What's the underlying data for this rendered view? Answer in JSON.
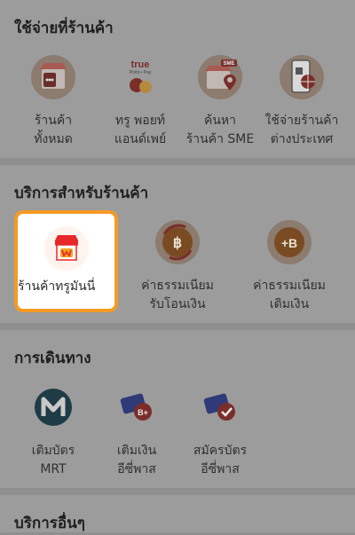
{
  "sections": {
    "spend_at_store": {
      "title": "ใช้จ่ายที่ร้านค้า",
      "items": [
        {
          "line1": "ร้านค้า",
          "line2": "ทั้งหมด",
          "icon": "store-icon"
        },
        {
          "line1": "ทรู พอยท์",
          "line2": "แอนด์เพย์",
          "icon": "true-point-pay-icon",
          "brand_top": "true",
          "brand_bottom": "Point • Pay"
        },
        {
          "line1": "ค้นหา",
          "line2": "ร้านค้า SME",
          "icon": "sme-store-location-icon",
          "badge": "SME"
        },
        {
          "line1": "ใช้จ่ายร้านค้า",
          "line2": "ต่างประเทศ",
          "icon": "international-payment-icon"
        }
      ]
    },
    "store_services": {
      "title": "บริการสำหรับร้านค้า",
      "items": [
        {
          "line1": "ร้านค้าทรูมันนี่",
          "line2": "",
          "icon": "truemoney-store-icon"
        },
        {
          "line1": "ค่าธรรมเนียม",
          "line2": "รับโอนเงิน",
          "icon": "transfer-fee-icon"
        },
        {
          "line1": "ค่าธรรมเนียม",
          "line2": "เติมเงิน",
          "icon": "topup-fee-icon",
          "coin_text": "+B"
        }
      ]
    },
    "travel": {
      "title": "การเดินทาง",
      "items": [
        {
          "line1": "เติมบัตร",
          "line2": "MRT",
          "icon": "mrt-icon"
        },
        {
          "line1": "เติมเงิน",
          "line2": "อีซี่พาส",
          "icon": "easy-pass-topup-icon",
          "badge": "B+"
        },
        {
          "line1": "สมัครบัตร",
          "line2": "อีซี่พาส",
          "icon": "easy-pass-register-icon"
        }
      ]
    },
    "other_services": {
      "title": "บริการอื่นๆ"
    }
  },
  "colors": {
    "highlight_border": "#f59a24",
    "overlay_bg": "#9c9c9c"
  }
}
